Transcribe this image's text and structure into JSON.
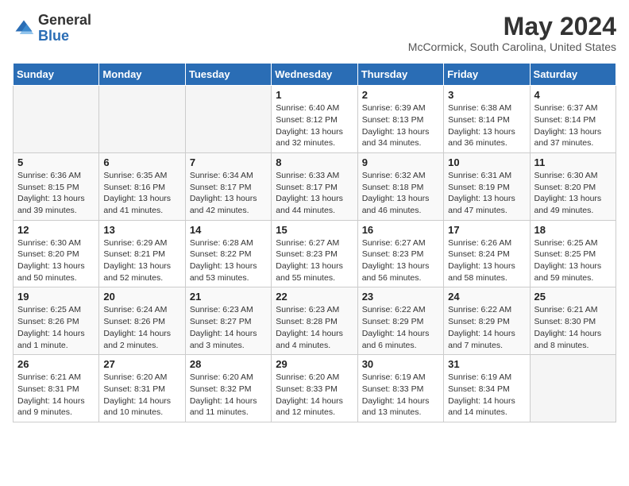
{
  "header": {
    "logo_general": "General",
    "logo_blue": "Blue",
    "month_year": "May 2024",
    "location": "McCormick, South Carolina, United States"
  },
  "days_of_week": [
    "Sunday",
    "Monday",
    "Tuesday",
    "Wednesday",
    "Thursday",
    "Friday",
    "Saturday"
  ],
  "weeks": [
    [
      {
        "day": "",
        "info": ""
      },
      {
        "day": "",
        "info": ""
      },
      {
        "day": "",
        "info": ""
      },
      {
        "day": "1",
        "info": "Sunrise: 6:40 AM\nSunset: 8:12 PM\nDaylight: 13 hours and 32 minutes."
      },
      {
        "day": "2",
        "info": "Sunrise: 6:39 AM\nSunset: 8:13 PM\nDaylight: 13 hours and 34 minutes."
      },
      {
        "day": "3",
        "info": "Sunrise: 6:38 AM\nSunset: 8:14 PM\nDaylight: 13 hours and 36 minutes."
      },
      {
        "day": "4",
        "info": "Sunrise: 6:37 AM\nSunset: 8:14 PM\nDaylight: 13 hours and 37 minutes."
      }
    ],
    [
      {
        "day": "5",
        "info": "Sunrise: 6:36 AM\nSunset: 8:15 PM\nDaylight: 13 hours and 39 minutes."
      },
      {
        "day": "6",
        "info": "Sunrise: 6:35 AM\nSunset: 8:16 PM\nDaylight: 13 hours and 41 minutes."
      },
      {
        "day": "7",
        "info": "Sunrise: 6:34 AM\nSunset: 8:17 PM\nDaylight: 13 hours and 42 minutes."
      },
      {
        "day": "8",
        "info": "Sunrise: 6:33 AM\nSunset: 8:17 PM\nDaylight: 13 hours and 44 minutes."
      },
      {
        "day": "9",
        "info": "Sunrise: 6:32 AM\nSunset: 8:18 PM\nDaylight: 13 hours and 46 minutes."
      },
      {
        "day": "10",
        "info": "Sunrise: 6:31 AM\nSunset: 8:19 PM\nDaylight: 13 hours and 47 minutes."
      },
      {
        "day": "11",
        "info": "Sunrise: 6:30 AM\nSunset: 8:20 PM\nDaylight: 13 hours and 49 minutes."
      }
    ],
    [
      {
        "day": "12",
        "info": "Sunrise: 6:30 AM\nSunset: 8:20 PM\nDaylight: 13 hours and 50 minutes."
      },
      {
        "day": "13",
        "info": "Sunrise: 6:29 AM\nSunset: 8:21 PM\nDaylight: 13 hours and 52 minutes."
      },
      {
        "day": "14",
        "info": "Sunrise: 6:28 AM\nSunset: 8:22 PM\nDaylight: 13 hours and 53 minutes."
      },
      {
        "day": "15",
        "info": "Sunrise: 6:27 AM\nSunset: 8:23 PM\nDaylight: 13 hours and 55 minutes."
      },
      {
        "day": "16",
        "info": "Sunrise: 6:27 AM\nSunset: 8:23 PM\nDaylight: 13 hours and 56 minutes."
      },
      {
        "day": "17",
        "info": "Sunrise: 6:26 AM\nSunset: 8:24 PM\nDaylight: 13 hours and 58 minutes."
      },
      {
        "day": "18",
        "info": "Sunrise: 6:25 AM\nSunset: 8:25 PM\nDaylight: 13 hours and 59 minutes."
      }
    ],
    [
      {
        "day": "19",
        "info": "Sunrise: 6:25 AM\nSunset: 8:26 PM\nDaylight: 14 hours and 1 minute."
      },
      {
        "day": "20",
        "info": "Sunrise: 6:24 AM\nSunset: 8:26 PM\nDaylight: 14 hours and 2 minutes."
      },
      {
        "day": "21",
        "info": "Sunrise: 6:23 AM\nSunset: 8:27 PM\nDaylight: 14 hours and 3 minutes."
      },
      {
        "day": "22",
        "info": "Sunrise: 6:23 AM\nSunset: 8:28 PM\nDaylight: 14 hours and 4 minutes."
      },
      {
        "day": "23",
        "info": "Sunrise: 6:22 AM\nSunset: 8:29 PM\nDaylight: 14 hours and 6 minutes."
      },
      {
        "day": "24",
        "info": "Sunrise: 6:22 AM\nSunset: 8:29 PM\nDaylight: 14 hours and 7 minutes."
      },
      {
        "day": "25",
        "info": "Sunrise: 6:21 AM\nSunset: 8:30 PM\nDaylight: 14 hours and 8 minutes."
      }
    ],
    [
      {
        "day": "26",
        "info": "Sunrise: 6:21 AM\nSunset: 8:31 PM\nDaylight: 14 hours and 9 minutes."
      },
      {
        "day": "27",
        "info": "Sunrise: 6:20 AM\nSunset: 8:31 PM\nDaylight: 14 hours and 10 minutes."
      },
      {
        "day": "28",
        "info": "Sunrise: 6:20 AM\nSunset: 8:32 PM\nDaylight: 14 hours and 11 minutes."
      },
      {
        "day": "29",
        "info": "Sunrise: 6:20 AM\nSunset: 8:33 PM\nDaylight: 14 hours and 12 minutes."
      },
      {
        "day": "30",
        "info": "Sunrise: 6:19 AM\nSunset: 8:33 PM\nDaylight: 14 hours and 13 minutes."
      },
      {
        "day": "31",
        "info": "Sunrise: 6:19 AM\nSunset: 8:34 PM\nDaylight: 14 hours and 14 minutes."
      },
      {
        "day": "",
        "info": ""
      }
    ]
  ]
}
